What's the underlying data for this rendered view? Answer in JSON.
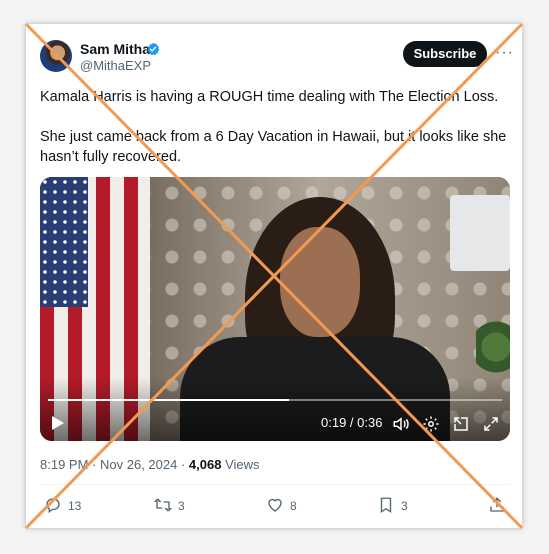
{
  "author": {
    "name": "Sam Mitha",
    "handle": "@MithaEXP"
  },
  "subscribe_label": "Subscribe",
  "more_label": "···",
  "tweet": {
    "line1": "Kamala Harris is having a ROUGH time dealing with The Election Loss.",
    "line2": "She just came back from a 6 Day Vacation in Hawaii, but it looks like she hasn’t fully recovered."
  },
  "video": {
    "time": "0:19 / 0:36",
    "progress_fraction": 0.53
  },
  "meta": {
    "time": "8:19 PM",
    "date": "Nov 26, 2024",
    "views_count": "4,068",
    "views_label": "Views"
  },
  "actions": {
    "replies": "13",
    "reposts": "3",
    "likes": "8",
    "bookmarks": "3"
  },
  "colors": {
    "verified": "#1d9bf0",
    "cross": "#f29a52",
    "text": "#0f1419",
    "muted": "#536471"
  }
}
